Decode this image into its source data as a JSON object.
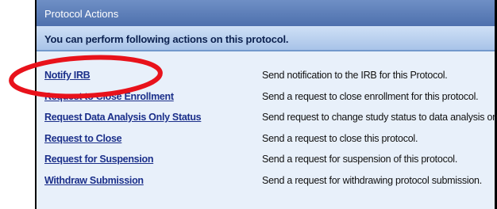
{
  "panel": {
    "title": "Protocol Actions",
    "subtitle": "You can perform following actions on this protocol."
  },
  "actions": [
    {
      "label": "Notify IRB",
      "description": "Send notification to the IRB for this Protocol."
    },
    {
      "label": "Request to Close Enrollment",
      "description": "Send a request to close enrollment for this protocol."
    },
    {
      "label": "Request Data Analysis Only Status",
      "description": "Send request to change study status to data analysis only."
    },
    {
      "label": "Request to Close",
      "description": "Send a request to close this protocol."
    },
    {
      "label": "Request for Suspension",
      "description": "Send a request for suspension of this protocol."
    },
    {
      "label": "Withdraw Submission",
      "description": "Send a request for withdrawing protocol submission."
    }
  ],
  "colors": {
    "header": "#5a7bb8",
    "link": "#1b2f8a",
    "annotation": "#e8121b"
  }
}
